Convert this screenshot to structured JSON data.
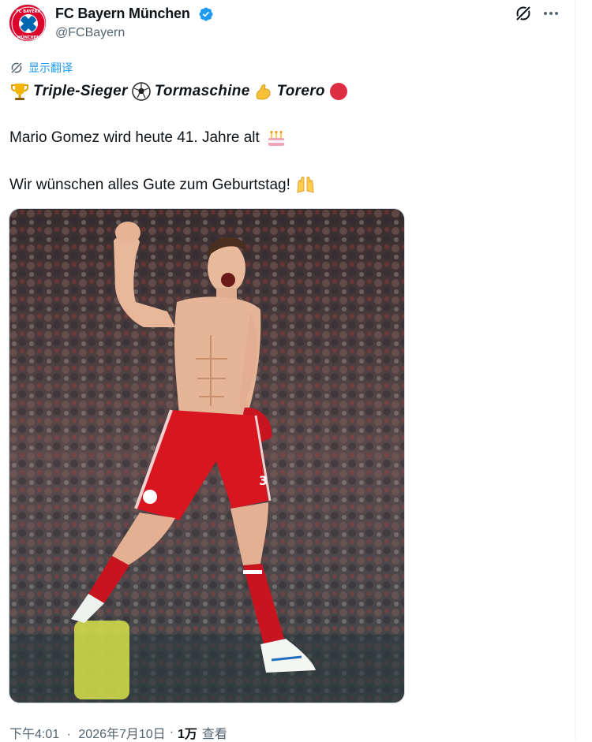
{
  "account": {
    "name": "FC Bayern München",
    "handle": "@FCBayern",
    "logo_top_text": "FC BAYERN",
    "logo_bottom_text": "MÜNCHEN"
  },
  "translate": {
    "label": "显示翻译"
  },
  "tweet": {
    "line1": {
      "seg1": "Triple-Sieger",
      "seg2": "Tormaschine",
      "seg3": "Torero"
    },
    "line2": "Mario Gomez wird heute 41. Jahre alt",
    "line3": "Wir wünschen alles Gute zum Geburtstag!"
  },
  "meta": {
    "time": "下午4:01",
    "date": "2026年7月10日",
    "views_count": "1万",
    "views_label": "查看",
    "separator": "·"
  },
  "colors": {
    "bayern_red": "#dc052d",
    "link_blue": "#1d9bf0",
    "verified_blue": "#1d9bf0",
    "secondary_text": "#536471"
  },
  "icons": {
    "header_right": [
      "grok-icon",
      "more-icon"
    ],
    "emojis": [
      "trophy-icon",
      "soccer-ball-icon",
      "flexed-biceps-icon",
      "red-circle-icon",
      "birthday-cake-icon",
      "raising-hands-icon"
    ]
  }
}
